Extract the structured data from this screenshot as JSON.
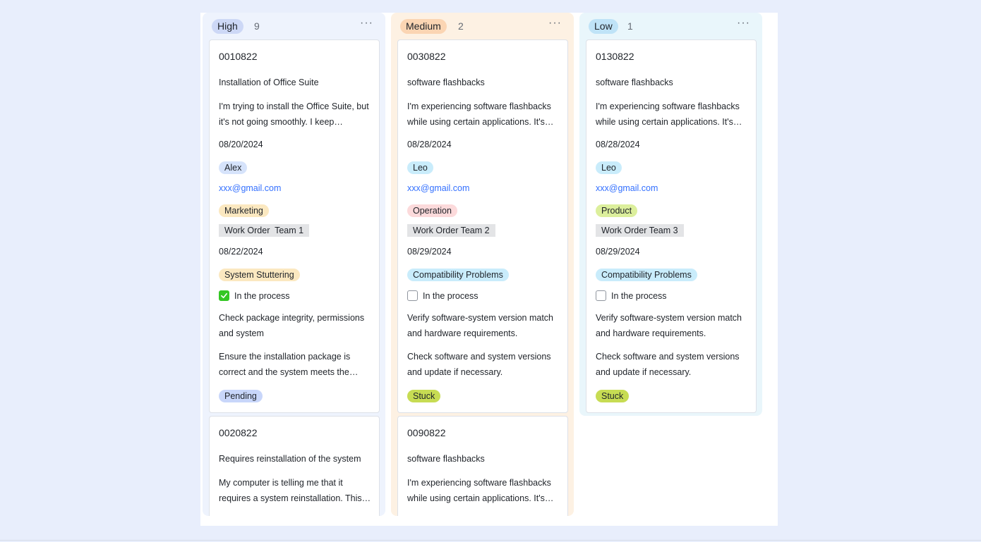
{
  "columns": [
    {
      "priority": "High",
      "count": "9",
      "more": "···",
      "cards": [
        {
          "id": "0010822",
          "title": "Installation of Office Suite",
          "description": "I'm trying to install the Office Suite, but it's not going smoothly. I keep encountering errors during installation.",
          "date": "08/20/2024",
          "person": "Alex",
          "email": "xxx@gmail.com",
          "department": "Marketing",
          "team": "Work Order  Team 1",
          "date2": "08/22/2024",
          "category": "System Stuttering",
          "checked": true,
          "check_label": "In the process",
          "reason": "Check package integrity, permissions and system",
          "solution": "Ensure the installation package is correct and the system meets the requirements.",
          "status": "Pending"
        },
        {
          "id": "0020822",
          "title": "Requires reinstallation of the system",
          "description": "My computer is telling me that it requires a system reinstallation. This happened suddenly."
        }
      ]
    },
    {
      "priority": "Medium",
      "count": "2",
      "more": "···",
      "cards": [
        {
          "id": "0030822",
          "title": "software flashbacks",
          "description": "I'm experiencing software flashbacks while using certain applications. It's very frustrating.",
          "date": "08/28/2024",
          "person": "Leo",
          "email": "xxx@gmail.com",
          "department": "Operation",
          "team": "Work Order Team 2",
          "date2": "08/29/2024",
          "category": "Compatibility Problems",
          "checked": false,
          "check_label": "In the process",
          "reason": "Verify software-system version match and hardware requirements.",
          "solution": "Check software and system versions and update if necessary.",
          "status": "Stuck"
        },
        {
          "id": "0090822",
          "title": "software flashbacks",
          "description": "I'm experiencing software flashbacks while using certain applications. It's very frustrating."
        }
      ]
    },
    {
      "priority": "Low",
      "count": "1",
      "more": "···",
      "cards": [
        {
          "id": "0130822",
          "title": "software flashbacks",
          "description": "I'm experiencing software flashbacks while using certain applications. It's very frustrating.",
          "date": "08/28/2024",
          "person": "Leo",
          "email": "xxx@gmail.com",
          "department": "Product",
          "team": "Work Order Team 3",
          "date2": "08/29/2024",
          "category": "Compatibility Problems",
          "checked": false,
          "check_label": "In the process",
          "reason": "Verify software-system version match and hardware requirements.",
          "solution": "Check software and system versions and update if necessary.",
          "status": "Stuck"
        }
      ]
    }
  ],
  "colors": {
    "person_tag": [
      "#d6e3fb",
      "#c9ecfb",
      "#c9ecfb"
    ],
    "department_tag": [
      "#fbe8c0",
      "#fcdadb",
      "#dcef9c"
    ],
    "category_tag": [
      "#fbe8c0",
      "#c9ecfb",
      "#c9ecfb"
    ],
    "status_tag": [
      "#c8d6fa",
      "#c7dc53",
      "#c7dc53"
    ],
    "link": "#3370ff",
    "check_green": "#34c724"
  }
}
